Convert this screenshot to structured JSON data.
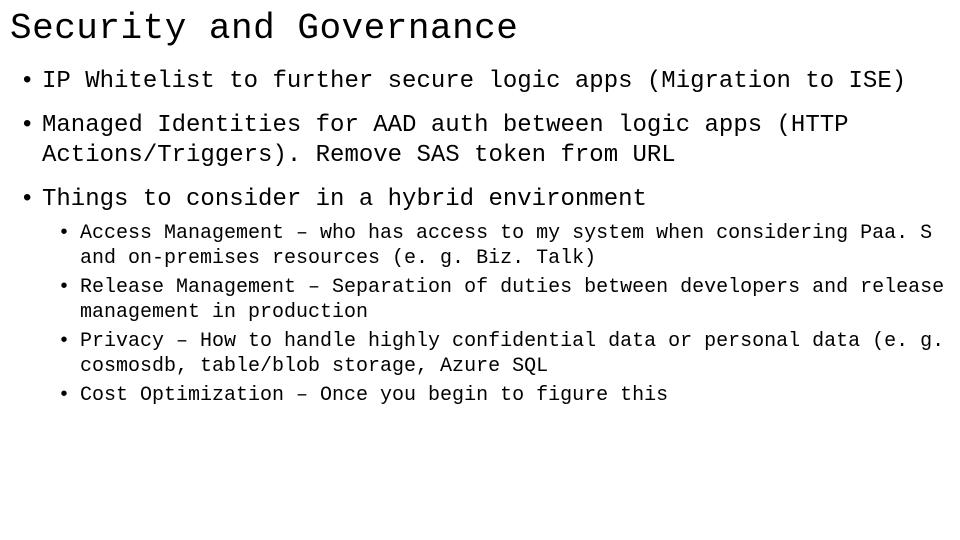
{
  "title": "Security and Governance",
  "bullets": [
    "IP Whitelist to further secure logic apps (Migration to ISE)",
    "Managed Identities for AAD auth between logic apps (HTTP Actions/Triggers).  Remove SAS token from URL",
    "Things to consider in a hybrid environment"
  ],
  "subbullets": [
    "Access Management – who has access to my system when considering Paa. S and on-premises resources (e. g. Biz. Talk)",
    "Release Management – Separation of duties between developers and release management in production",
    "Privacy – How to handle highly confidential data or personal data (e. g. cosmosdb, table/blob storage, Azure SQL",
    "Cost Optimization – Once you begin to figure this"
  ]
}
